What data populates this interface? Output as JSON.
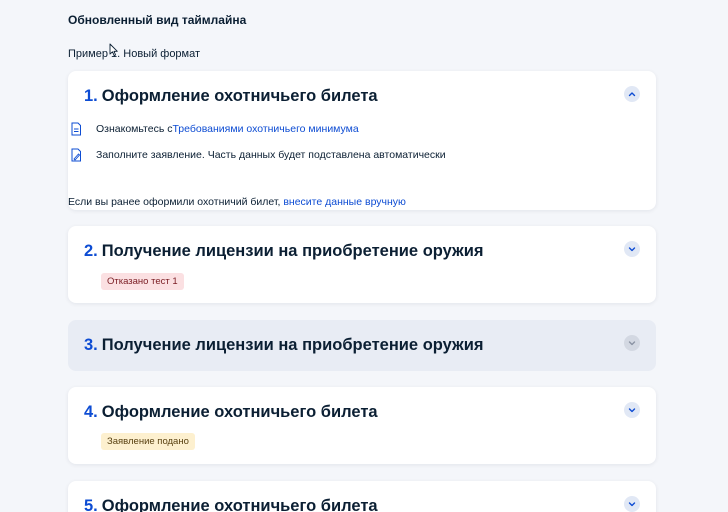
{
  "page": {
    "title": "Обновленный вид таймлайна",
    "example_label": "Пример 1. Новый формат"
  },
  "steps": [
    {
      "number": "1.",
      "title": "Оформление охотничьего билета",
      "expanded": true,
      "chevron": "chevron-up-icon",
      "items": [
        {
          "icon": "document-icon",
          "prefix": "Ознакомьтесь с ",
          "link": "Требованиями охотничьего минимума",
          "suffix": ""
        },
        {
          "icon": "form-edit-icon",
          "prefix": "Заполните заявление. Часть данных будет подставлена автоматически",
          "link": "",
          "suffix": ""
        }
      ],
      "footer_prefix": "Если вы ранее оформили охотничий билет, ",
      "footer_link": "внесите данные вручную"
    },
    {
      "number": "2.",
      "title": "Получение лицензии на приобретение оружия",
      "chevron": "chevron-down-icon",
      "badge": "Отказано тест 1",
      "badge_color": "#fbe0e2"
    },
    {
      "number": "3.",
      "title": "Получение лицензии на приобретение оружия",
      "chevron": "chevron-down-icon",
      "disabled": true
    },
    {
      "number": "4.",
      "title": "Оформление охотничьего билета",
      "chevron": "chevron-down-icon",
      "badge": "Заявление подано",
      "badge_color": "#fdf0cf"
    },
    {
      "number": "5.",
      "title": "Оформление охотничьего билета",
      "chevron": "chevron-down-icon"
    }
  ],
  "colors": {
    "accent": "#0d4cd3",
    "text": "#0b1f33",
    "background": "#f4f6fa"
  }
}
